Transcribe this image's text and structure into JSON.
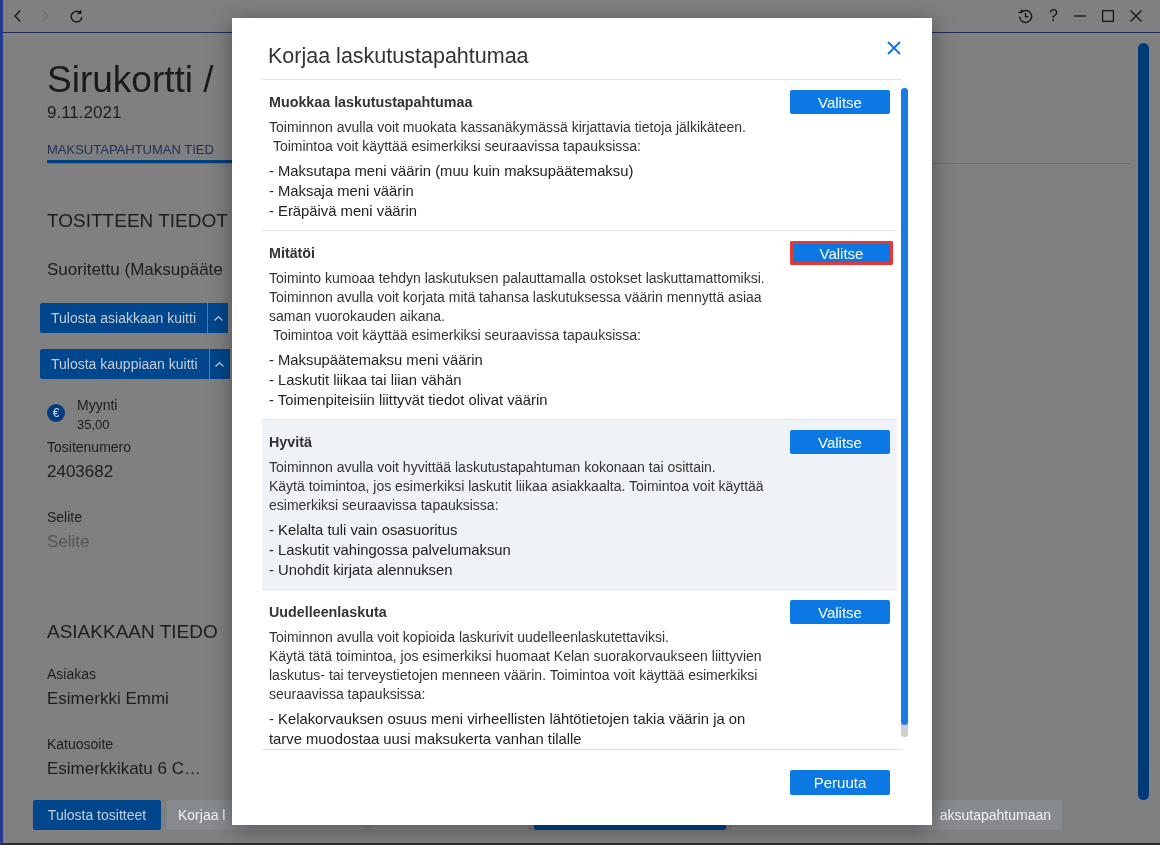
{
  "window": {
    "nav": [
      {
        "kind": "back",
        "disabled": false
      },
      {
        "kind": "forward",
        "disabled": true
      },
      {
        "kind": "reload",
        "disabled": false
      }
    ],
    "tools": [
      {
        "kind": "history"
      },
      {
        "kind": "help",
        "glyph": "?"
      },
      {
        "kind": "minimize"
      },
      {
        "kind": "maximize"
      },
      {
        "kind": "close"
      }
    ]
  },
  "page": {
    "title": "Sirukortti /",
    "date": "9.11.2021",
    "tabs": [
      {
        "label": "MAKSUTAPAHTUMAN TIED",
        "selected": true
      }
    ],
    "receipt": {
      "heading": "TOSITTEEN TIEDOT",
      "status": "Suoritettu (Maksupääte",
      "print_buttons": [
        {
          "label": "Tulosta asiakkaan kuitti"
        },
        {
          "label": "Tulosta kauppiaan kuitti"
        }
      ],
      "payment": {
        "icon": "€",
        "label": "Myynti",
        "amount": "35,00"
      },
      "fields": [
        {
          "kind": "value",
          "label": "Tositenumero",
          "value": "2403682"
        },
        {
          "kind": "input",
          "label": "Selite",
          "placeholder": "Selite"
        }
      ]
    },
    "customer": {
      "heading": "ASIAKKAAN TIEDO",
      "fields": [
        {
          "kind": "value",
          "label": "Asiakas",
          "value": "Esimerkki Emmi"
        },
        {
          "kind": "value",
          "label": "Katuosoite",
          "value": "Esimerkkikatu 6 C…"
        }
      ]
    }
  },
  "bottom_bar": {
    "buttons": [
      {
        "label": "Tulosta tositteet",
        "disabled": false
      },
      {
        "label": "Korjaa l",
        "disabled": true
      },
      {
        "disabled": true
      },
      {
        "disabled": false
      },
      {
        "label": "aksutapahtumaan",
        "disabled": true
      }
    ]
  },
  "dialog": {
    "title": "Korjaa laskutustapahtumaa",
    "options": [
      {
        "title": "Muokkaa laskutustapahtumaa",
        "button": "Valitse",
        "highlighted": false,
        "hovered": false,
        "paragraphs": [
          "Toiminnon avulla voit muokata kassanäkymässä kirjattavia tietoja jälkikäteen.",
          " Toimintoa voit käyttää esimerkiksi seuraavissa tapauksissa:"
        ],
        "items": [
          "- Maksutapa meni väärin (muu kuin maksupäätemaksu)",
          "- Maksaja meni väärin",
          "- Eräpäivä meni väärin"
        ]
      },
      {
        "title": "Mitätöi",
        "button": "Valitse",
        "highlighted": true,
        "hovered": false,
        "paragraphs": [
          "Toiminto kumoaa tehdyn laskutuksen palauttamalla ostokset laskuttamattomiksi.",
          "Toiminnon avulla voit korjata mitä tahansa laskutuksessa väärin mennyttä asiaa saman vuorokauden aikana.",
          " Toimintoa voit käyttää esimerkiksi seuraavissa tapauksissa:"
        ],
        "items": [
          "- Maksupäätemaksu meni väärin",
          "- Laskutit liikaa tai liian vähän",
          "- Toimenpiteisiin liittyvät tiedot olivat väärin"
        ]
      },
      {
        "title": "Hyvitä",
        "button": "Valitse",
        "highlighted": false,
        "hovered": true,
        "paragraphs": [
          "Toiminnon avulla voit hyvittää laskutustapahtuman kokonaan tai osittain.",
          "Käytä toimintoa, jos esimerkiksi laskutit liikaa asiakkaalta. Toimintoa voit käyttää esimerkiksi seuraavissa tapauksissa:"
        ],
        "items": [
          "- Kelalta tuli vain osasuoritus",
          "- Laskutit vahingossa palvelumaksun",
          "- Unohdit kirjata alennuksen"
        ]
      },
      {
        "title": "Uudelleenlaskuta",
        "button": "Valitse",
        "highlighted": false,
        "hovered": false,
        "paragraphs": [
          "Toiminnon avulla voit kopioida laskurivit uudelleenlaskutettaviksi.",
          "Käytä tätä toimintoa, jos esimerkiksi huomaat Kelan suorakorvaukseen liittyvien laskutus- tai terveystietojen menneen väärin. Toimintoa voit käyttää esimerkiksi seuraavissa tapauksissa:"
        ],
        "items": [
          "- Kelakorvauksen osuus meni virheellisten lähtötietojen takia väärin ja on tarve muodostaa uusi maksukerta vanhan tilalle"
        ]
      }
    ],
    "cancel": "Peruuta"
  }
}
